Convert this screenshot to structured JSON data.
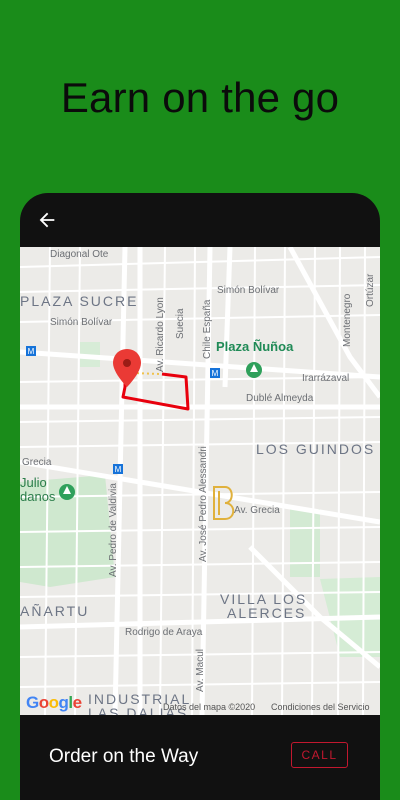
{
  "headline": "Earn on the go",
  "map": {
    "labels": {
      "diagonal_ote": "Diagonal Ote",
      "plaza_sucre": "PLAZA SUCRE",
      "simon_bolivar_1": "Simón Bolívar",
      "simon_bolivar_2": "Simón Bolívar",
      "ortuzar": "Ortúzar",
      "montenegro": "Montenegro",
      "av_ricardo_lyon": "Av. Ricardo Lyon",
      "suecia": "Suecia",
      "chile_espana": "Chile España",
      "plaza_nunoa": "Plaza Ñuñoa",
      "irarrazaval": "Irarrázaval",
      "duble_almeyda": "Dublé Almeyda",
      "los_guindos": "LOS GUINDOS",
      "grecia_1": "Grecia",
      "grecia_2": "Av. Grecia",
      "julio": "Julio",
      "danos": "danos",
      "av_pedro_de_valdivia": "Av. Pedro de Valdivia",
      "av_jose_pedro_alessandri": "Av. José Pedro Alessandri",
      "villa_los_alerces_1": "VILLA LOS",
      "villa_los_alerces_2": "ALERCES",
      "anartu": "AÑARTU",
      "rodrigo_de_araya": "Rodrigo de Araya",
      "av_macul": "Av. Macul",
      "industrial_1": "INDUSTRIAL",
      "industrial_2": "LAS DALIAS"
    },
    "google_logo": "Google",
    "map_data_text": "Datos del mapa ©2020",
    "terms_text": "Condiciones del Servicio"
  },
  "bottom": {
    "status": "Order on the Way",
    "call_label": "CALL"
  },
  "colors": {
    "background": "#1a8c1a",
    "route": "#e8000d",
    "call": "#c2182f"
  }
}
